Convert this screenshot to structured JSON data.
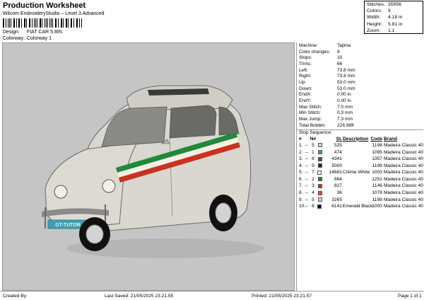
{
  "header": {
    "title": "Production Worksheet",
    "subtitle": "Wilcom EmbroideryStudio – Level 3 Advanced",
    "design_label": "Design:",
    "design_value": "FIAT CAR 5,8IN",
    "colorway_label": "Colorway:",
    "colorway_value": "Colorway 1"
  },
  "stats": [
    {
      "k": "Stitches:",
      "v": "35956"
    },
    {
      "k": "Colors:",
      "v": "9"
    },
    {
      "k": "Width:",
      "v": "4.18 in"
    },
    {
      "k": "Height:",
      "v": "5.81 in"
    },
    {
      "k": "Zoom:",
      "v": "1:1"
    }
  ],
  "machine": [
    {
      "k": "Machine:",
      "v": "Tajima"
    },
    {
      "k": "Color changes:",
      "v": "9"
    },
    {
      "k": "Stops:",
      "v": "10"
    },
    {
      "k": "Trims:",
      "v": "66"
    },
    {
      "k": "Left:",
      "v": "73.8 mm"
    },
    {
      "k": "Right:",
      "v": "73.8 mm"
    },
    {
      "k": "Up:",
      "v": "53.0 mm"
    },
    {
      "k": "Down:",
      "v": "53.0 mm"
    },
    {
      "k": "EndX:",
      "v": "0.00 in"
    },
    {
      "k": "EndY:",
      "v": "0.00 in"
    },
    {
      "k": "Max Stitch:",
      "v": "7.0 mm"
    },
    {
      "k": "Min Stitch:",
      "v": "0.3 mm"
    },
    {
      "k": "Max Jump:",
      "v": "7.3 mm"
    },
    {
      "k": "Total Bobbin:",
      "v": "226.98ft"
    }
  ],
  "sequence": {
    "title": "Stop Sequence:",
    "headers": {
      "num": "#",
      "n": "N#",
      "st": "St.",
      "desc": "Description",
      "code": "Code",
      "brand": "Brand"
    },
    "rows": [
      {
        "num": "1.",
        "n": "5",
        "color": "#d3d3d3",
        "st": "525",
        "desc": "",
        "code": "1198",
        "brand": "Madeira Classic 40"
      },
      {
        "num": "2.",
        "n": "1",
        "color": "#3aa1b3",
        "st": "474",
        "desc": "",
        "code": "1095",
        "brand": "Madeira Classic 40"
      },
      {
        "num": "3.",
        "n": "8",
        "color": "#505050",
        "st": "4341",
        "desc": "",
        "code": "1357",
        "brand": "Madeira Classic 40"
      },
      {
        "num": "4.",
        "n": "9",
        "color": "#1b2a4a",
        "st": "5000",
        "desc": "",
        "code": "1199",
        "brand": "Madeira Classic 40"
      },
      {
        "num": "5.",
        "n": "7",
        "color": "#f3f0e6",
        "st": "14681",
        "desc": "Crème White",
        "code": "1003",
        "brand": "Madeira Classic 40"
      },
      {
        "num": "6.",
        "n": "2",
        "color": "#1e8a3a",
        "st": "664",
        "desc": "",
        "code": "1251",
        "brand": "Madeira Classic 40"
      },
      {
        "num": "7.",
        "n": "3",
        "color": "#c8321e",
        "st": "827",
        "desc": "",
        "code": "1146",
        "brand": "Madeira Classic 40"
      },
      {
        "num": "8.",
        "n": "4",
        "color": "#e04b37",
        "st": "36",
        "desc": "",
        "code": "1078",
        "brand": "Madeira Classic 40"
      },
      {
        "num": "9.",
        "n": "5",
        "color": "#d3d3d3",
        "st": "3265",
        "desc": "",
        "code": "1198",
        "brand": "Madeira Classic 40"
      },
      {
        "num": "10.",
        "n": "6",
        "color": "#111111",
        "st": "6141",
        "desc": "Emerald Black",
        "code": "1000",
        "brand": "Madeira Classic 40"
      }
    ]
  },
  "plate_text": "GT-TUTOR",
  "footer": {
    "created": "Created By:",
    "saved": "Last Saved: 21/05/2025 23.21.55",
    "printed": "Printed: 21/05/2025 23.21.57",
    "page": "Page 1 of 1"
  }
}
